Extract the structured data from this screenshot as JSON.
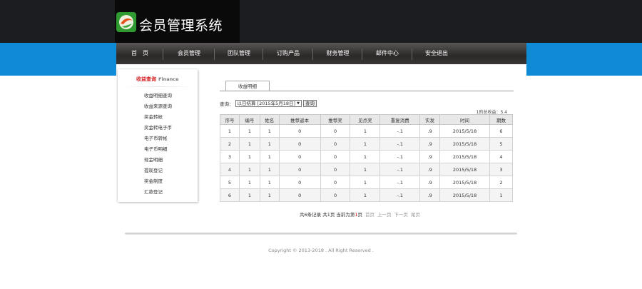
{
  "brand": {
    "title": "会员管理系统",
    "accent": "#0f8ad4"
  },
  "nav": [
    "首　页",
    "会员管理",
    "团队管理",
    "订购产品",
    "财务管理",
    "邮件中心",
    "安全退出"
  ],
  "sidebar": {
    "heading": "收益查询",
    "heading_en": "Finance",
    "items": [
      "收益明细查询",
      "收益来源查询",
      "奖金转帐",
      "奖金转电子币",
      "电子币转帐",
      "电子币明细",
      "现金明细",
      "提现登记",
      "奖金制度",
      "汇款登记"
    ]
  },
  "tab": {
    "label": "收益明细"
  },
  "query": {
    "label": "查询：",
    "select_value": "以日结算 [2015年5月18日]",
    "button": "查询"
  },
  "total_text": "1的总收益：5.4",
  "table": {
    "headers": [
      "序号",
      "编号",
      "姓名",
      "推荐返本",
      "推荐奖",
      "见点奖",
      "重复消费",
      "实发",
      "时间",
      "期数"
    ],
    "rows": [
      [
        "1",
        "1",
        "1",
        "0",
        "0",
        "1",
        "-.1",
        ".9",
        "2015/5/18",
        "6"
      ],
      [
        "2",
        "1",
        "1",
        "0",
        "0",
        "1",
        "-.1",
        ".9",
        "2015/5/18",
        "5"
      ],
      [
        "3",
        "1",
        "1",
        "0",
        "0",
        "1",
        "-.1",
        ".9",
        "2015/5/18",
        "4"
      ],
      [
        "4",
        "1",
        "1",
        "0",
        "0",
        "1",
        "-.1",
        ".9",
        "2015/5/18",
        "3"
      ],
      [
        "5",
        "1",
        "1",
        "0",
        "0",
        "1",
        "-.1",
        ".9",
        "2015/5/18",
        "2"
      ],
      [
        "6",
        "1",
        "1",
        "0",
        "0",
        "1",
        "-.1",
        ".9",
        "2015/5/18",
        "1"
      ]
    ]
  },
  "pager": {
    "summary_a": "共6条记录 共1页 当前为第",
    "current": "1",
    "summary_b": "页",
    "first": "首页",
    "prev": "上一页",
    "next": "下一页",
    "last": "尾页"
  },
  "footer": {
    "copyright": "Copyright © 2013-2018 . All Right Reserved ."
  }
}
